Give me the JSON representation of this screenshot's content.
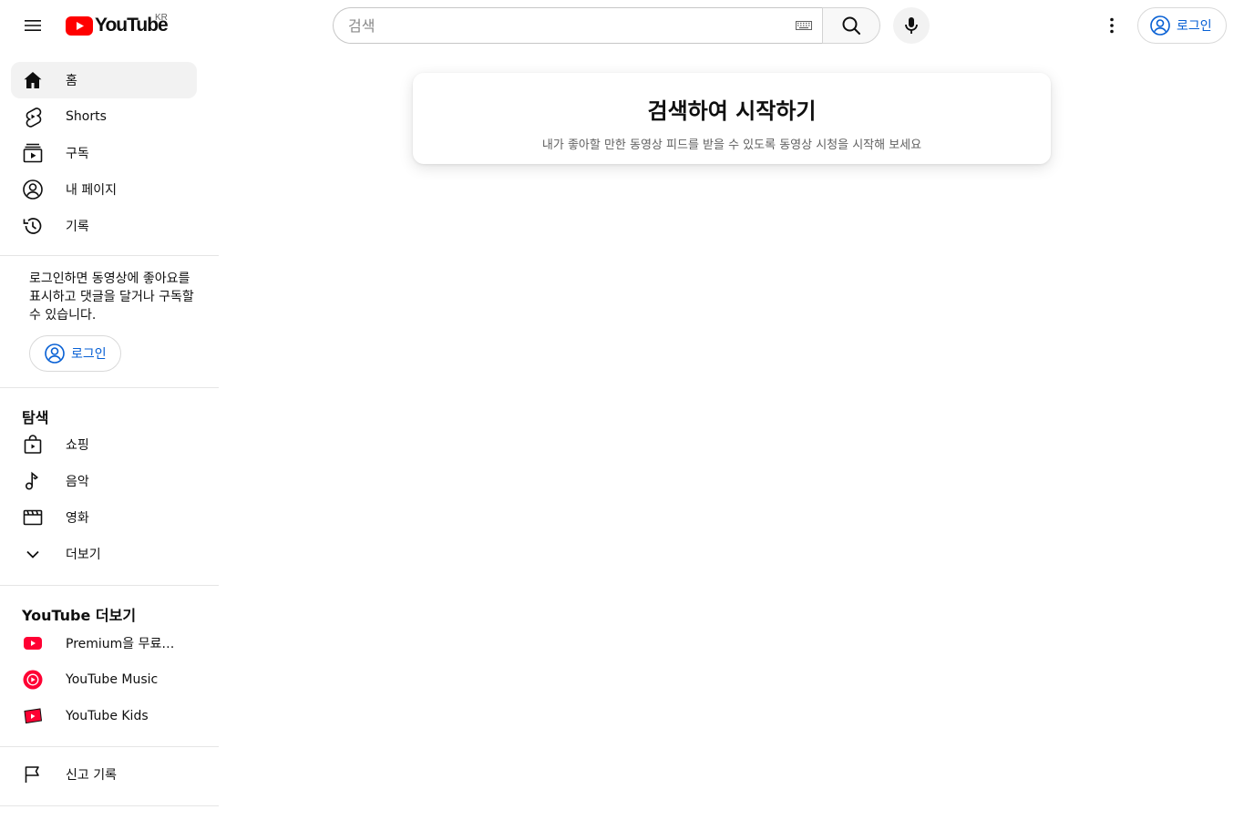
{
  "header": {
    "logo_text": "YouTube",
    "country_code": "KR",
    "search_placeholder": "검색",
    "signin_label": "로그인"
  },
  "sidebar": {
    "main_items": [
      {
        "label": "홈",
        "icon": "home-icon",
        "active": true
      },
      {
        "label": "Shorts",
        "icon": "shorts-icon"
      },
      {
        "label": "구독",
        "icon": "subscriptions-icon"
      },
      {
        "label": "내 페이지",
        "icon": "account-icon"
      },
      {
        "label": "기록",
        "icon": "history-icon"
      }
    ],
    "signin_note": "로그인하면 동영상에 좋아요를 표시하고 댓글을 달거나 구독할 수 있습니다.",
    "signin_label": "로그인",
    "explore_title": "탐색",
    "explore_items": [
      {
        "label": "쇼핑",
        "icon": "shopping-bag-icon"
      },
      {
        "label": "음악",
        "icon": "music-note-icon"
      },
      {
        "label": "영화",
        "icon": "clapperboard-icon"
      },
      {
        "label": "더보기",
        "icon": "chevron-down-icon"
      }
    ],
    "more_title": "YouTube 더보기",
    "more_items": [
      {
        "label": "Premium을 무료로 …",
        "icon": "youtube-premium-icon"
      },
      {
        "label": "YouTube Music",
        "icon": "youtube-music-icon"
      },
      {
        "label": "YouTube Kids",
        "icon": "youtube-kids-icon"
      }
    ],
    "report_item": {
      "label": "신고 기록",
      "icon": "flag-icon"
    }
  },
  "main": {
    "hint_title": "검색하여 시작하기",
    "hint_subtitle": "내가 좋아할 만한 동영상 피드를 받을 수 있도록 동영상 시청을 시작해 보세요"
  },
  "colors": {
    "brand_red": "#ff0000",
    "link_blue": "#065fd4",
    "active_bg": "#f2f2f2"
  }
}
